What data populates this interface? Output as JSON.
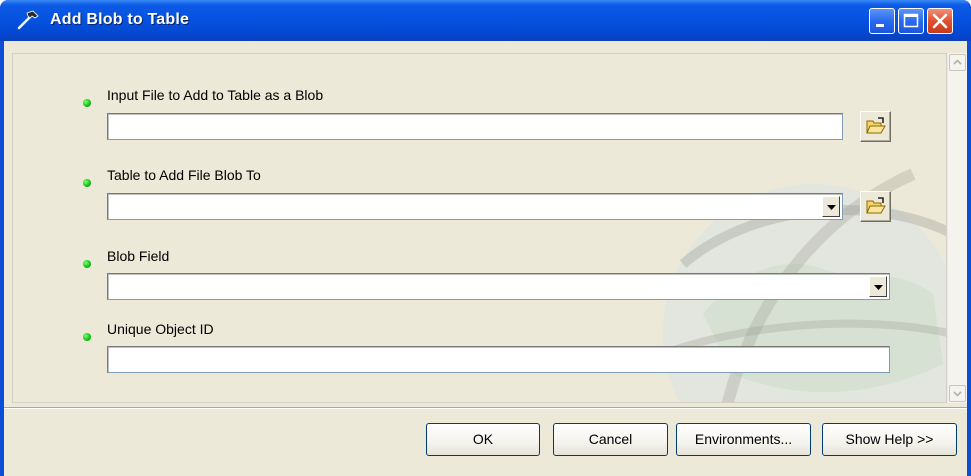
{
  "window": {
    "title": "Add Blob to Table",
    "icon": "hammer-tool-icon",
    "controls": [
      "minimize-icon",
      "maximize-icon",
      "close-icon"
    ]
  },
  "params": [
    {
      "label": "Input File to Add to Table as a Blob",
      "value": "",
      "type": "text",
      "browse": true
    },
    {
      "label": "Table to Add File Blob To",
      "value": "",
      "type": "dropdown",
      "browse": true
    },
    {
      "label": "Blob Field",
      "value": "",
      "type": "dropdown",
      "browse": false
    },
    {
      "label": "Unique Object ID",
      "value": "",
      "type": "text",
      "browse": false
    }
  ],
  "buttons": {
    "ok": "OK",
    "cancel": "Cancel",
    "environments": "Environments...",
    "show_help": "Show Help >>"
  },
  "colors": {
    "titlebar": "#0552e0",
    "dialog_bg": "#ece9d8",
    "required_dot": "#11c61a",
    "close_button": "#e0522e"
  }
}
